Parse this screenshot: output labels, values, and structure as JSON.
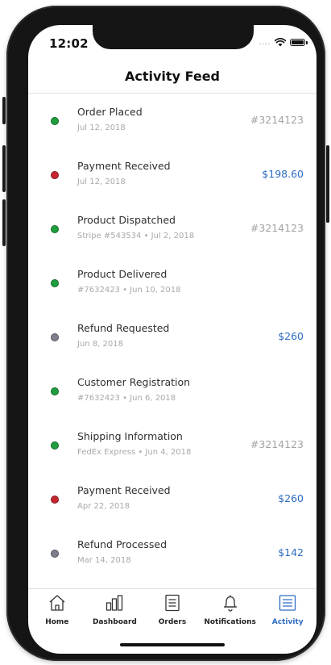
{
  "status_bar": {
    "time": "12:02",
    "signal": "...."
  },
  "header": {
    "title": "Activity Feed"
  },
  "colors": {
    "green": "#1f9e3e",
    "red": "#c6262e",
    "gray": "#7d7f8c",
    "accent": "#2d6cc2",
    "reference_text": "#a3a3a3"
  },
  "activity": [
    {
      "title": "Order Placed",
      "meta": "Jul 12, 2018",
      "value": "#3214123",
      "value_type": "ref",
      "status": "green"
    },
    {
      "title": "Payment Received",
      "meta": "Jul 12, 2018",
      "value": "$198.60",
      "value_type": "money",
      "status": "red"
    },
    {
      "title": "Product Dispatched",
      "meta": "Stripe #543534  •  Jul 2, 2018",
      "value": "#3214123",
      "value_type": "ref",
      "status": "green"
    },
    {
      "title": "Product Delivered",
      "meta": "#7632423  •  Jun 10, 2018",
      "value": "",
      "value_type": "none",
      "status": "green"
    },
    {
      "title": "Refund Requested",
      "meta": "Jun 8, 2018",
      "value": "$260",
      "value_type": "money",
      "status": "gray"
    },
    {
      "title": "Customer Registration",
      "meta": "#7632423  •  Jun 6, 2018",
      "value": "",
      "value_type": "none",
      "status": "green"
    },
    {
      "title": "Shipping Information",
      "meta": "FedEx Express  •  Jun 4, 2018",
      "value": "#3214123",
      "value_type": "ref",
      "status": "green"
    },
    {
      "title": "Payment Received",
      "meta": "Apr 22, 2018",
      "value": "$260",
      "value_type": "money",
      "status": "red"
    },
    {
      "title": "Refund Processed",
      "meta": "Mar 14, 2018",
      "value": "$142",
      "value_type": "money",
      "status": "gray"
    }
  ],
  "tabs": [
    {
      "label": "Home",
      "icon": "home-icon",
      "active": false
    },
    {
      "label": "Dashboard",
      "icon": "bar-chart-icon",
      "active": false
    },
    {
      "label": "Orders",
      "icon": "document-icon",
      "active": false
    },
    {
      "label": "Notifications",
      "icon": "bell-icon",
      "active": false
    },
    {
      "label": "Activity",
      "icon": "list-icon",
      "active": true
    }
  ]
}
